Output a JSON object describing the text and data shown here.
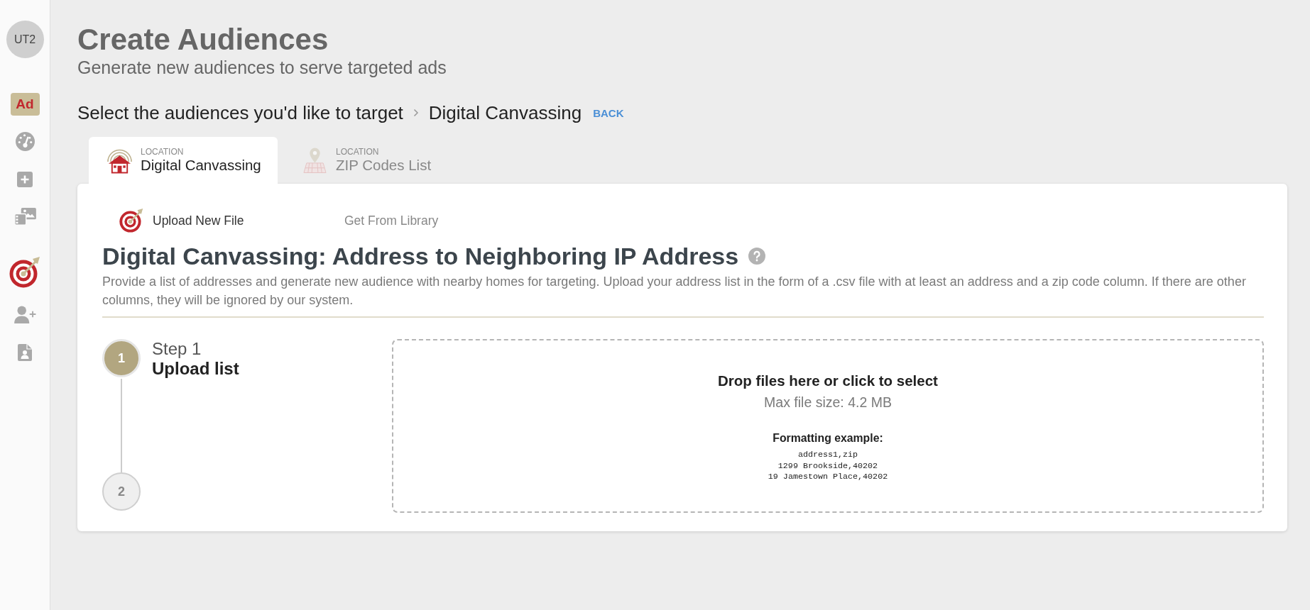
{
  "sidebar": {
    "avatar": "UT2",
    "sections": [
      {
        "items": [
          {
            "kind": "ad",
            "label": "Ad",
            "selected": false
          },
          {
            "kind": "dashboard",
            "selected": false
          },
          {
            "kind": "add",
            "selected": false
          },
          {
            "kind": "media",
            "selected": false
          }
        ]
      },
      {
        "items": [
          {
            "kind": "target",
            "selected": true
          },
          {
            "kind": "add-user",
            "selected": false
          },
          {
            "kind": "document",
            "selected": false
          }
        ]
      }
    ]
  },
  "header": {
    "title": "Create Audiences",
    "subtitle": "Generate new audiences to serve targeted ads"
  },
  "breadcrumb": {
    "items": [
      "Select the audiences you'd like to target",
      "Digital Canvassing"
    ],
    "back": "BACK"
  },
  "tabs": [
    {
      "kind": "canvassing",
      "category": "LOCATION",
      "label": "Digital Canvassing",
      "selected": true
    },
    {
      "kind": "zip",
      "category": "LOCATION",
      "label": "ZIP Codes List",
      "selected": false
    }
  ],
  "card": {
    "source_tabs": [
      {
        "label": "Upload New File",
        "selected": true
      },
      {
        "label": "Get From Library",
        "selected": false
      }
    ],
    "heading": "Digital Canvassing: Address to Neighboring IP Address",
    "description": "Provide a list of addresses and generate new audience with nearby homes for targeting. Upload your address list in the form of a .csv file with at least an address and a zip code column. If there are other columns, they will be ignored by our system.",
    "steps": [
      {
        "number": "1",
        "title": "Step 1",
        "subtitle": "Upload list",
        "active": true
      },
      {
        "number": "2",
        "active": false
      }
    ],
    "dropzone": {
      "prompt": "Drop files here or click to select",
      "limit": "Max file size: 4.2 MB",
      "example_title": "Formatting example:",
      "example_lines": [
        "address1,zip",
        "1299 Brookside,40202",
        "19 Jamestown Place,40202"
      ]
    }
  }
}
